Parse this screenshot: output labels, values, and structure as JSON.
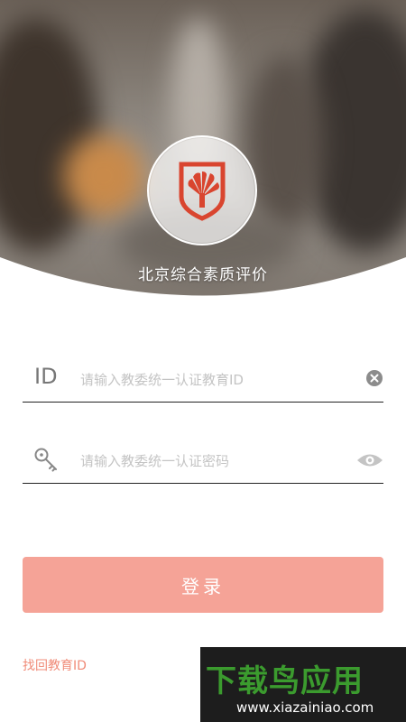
{
  "header": {
    "app_title": "北京综合素质评价"
  },
  "login": {
    "id_label": "ID",
    "id_placeholder": "请输入教委统一认证教育ID",
    "password_placeholder": "请输入教委统一认证密码",
    "login_button": "登录",
    "recover_link": "找回教育ID"
  },
  "watermark": {
    "title": "下载鸟应用",
    "url": "www.xiazainiao.com"
  },
  "colors": {
    "accent": "#f5a397",
    "link": "#f08b78",
    "logo_red": "#d9452f"
  },
  "icons": {
    "id_clear": "clear-icon",
    "password_key": "key-icon",
    "password_toggle": "eye-icon",
    "logo": "emblem-logo"
  }
}
